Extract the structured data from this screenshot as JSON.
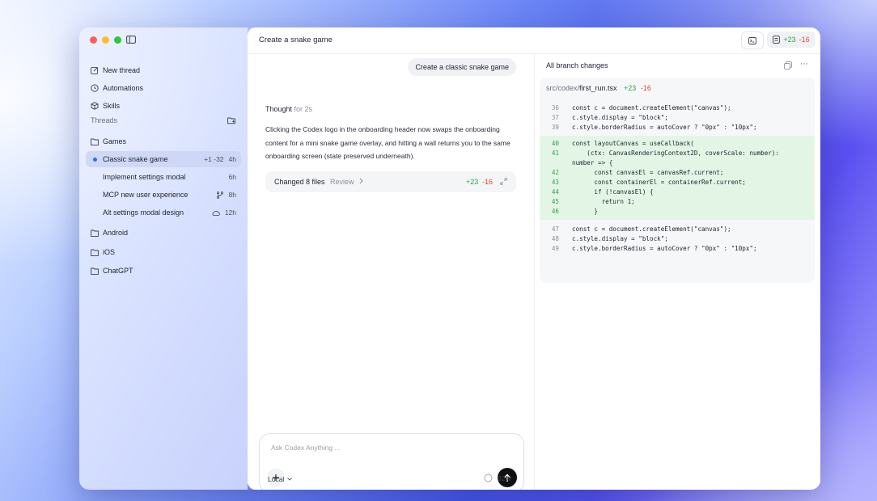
{
  "sidebar": {
    "nav": [
      {
        "label": "New thread",
        "icon": "edit-icon"
      },
      {
        "label": "Automations",
        "icon": "clock-icon"
      },
      {
        "label": "Skills",
        "icon": "cube-icon"
      }
    ],
    "threads_label": "Threads",
    "folders": {
      "games": "Games",
      "android": "Android",
      "ios": "iOS",
      "chatgpt": "ChatGPT"
    },
    "threads": [
      {
        "label": "Classic snake game",
        "meta": "+1 -32",
        "time": "4h",
        "active": true
      },
      {
        "label": "Implement settings modal",
        "time": "6h"
      },
      {
        "label": "MCP new user experience",
        "icon": "branch-icon",
        "time": "8h"
      },
      {
        "label": "Alt settings modal design",
        "icon": "cloud-icon",
        "time": "12h"
      }
    ]
  },
  "header": {
    "title": "Create a snake game",
    "diff_plus": "+23",
    "diff_minus": "-16"
  },
  "chat": {
    "user_message": "Create a classic snake game",
    "thought_label": "Thought",
    "thought_time": "for 2s",
    "reply": "Clicking the Codex logo in the onboarding header now swaps the onboarding content for a mini snake game overlay, and hitting a wall returns you to the same onboarding screen (state preserved underneath).",
    "changed_files": "Changed 8 files",
    "review": "Review",
    "plus": "+23",
    "minus": "-16"
  },
  "composer": {
    "placeholder": "Ask Codex Anything ...",
    "local_label": "Local",
    "context_pct": "82%"
  },
  "diff_panel": {
    "title": "All branch changes",
    "file_dir": "src/codex/",
    "file_name": "first_run.tsx",
    "plus": "+23",
    "minus": "-16",
    "block1": [
      {
        "ln": "36",
        "code": "const c = document.createElement(\"canvas\");"
      },
      {
        "ln": "37",
        "code": "c.style.display = \"block\";"
      },
      {
        "ln": "39",
        "code": "c.style.borderRadius = autoCover ? \"0px\" : \"10px\";"
      }
    ],
    "block2": [
      {
        "ln": "40",
        "code": "const layoutCanvas = useCallback("
      },
      {
        "ln": "41",
        "code": "    (ctx: CanvasRenderingContext2D, coverScale: number):"
      },
      {
        "ln": "",
        "code": "number => {"
      },
      {
        "ln": "42",
        "code": "      const canvasEl = canvasRef.current;"
      },
      {
        "ln": "43",
        "code": "      const containerEl = containerRef.current;"
      },
      {
        "ln": "44",
        "code": "      if (!canvasEl) {"
      },
      {
        "ln": "45",
        "code": "        return 1;"
      },
      {
        "ln": "46",
        "code": "      }"
      }
    ],
    "block3": [
      {
        "ln": "47",
        "code": "const c = document.createElement(\"canvas\");"
      },
      {
        "ln": "48",
        "code": "c.style.display = \"block\";"
      },
      {
        "ln": "49",
        "code": "c.style.borderRadius = autoCover ? \"0px\" : \"10px\";"
      }
    ]
  }
}
